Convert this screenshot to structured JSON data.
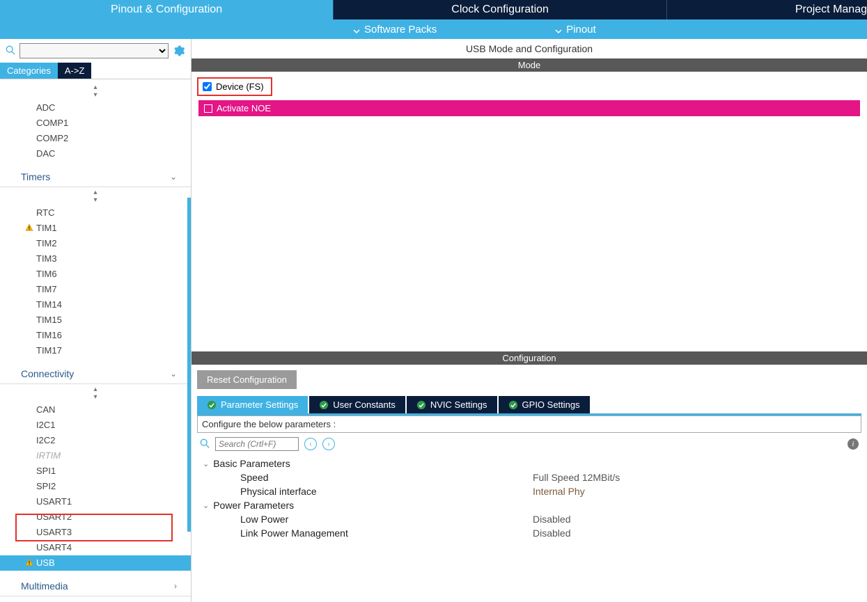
{
  "topTabs": {
    "pinout": "Pinout & Configuration",
    "clock": "Clock Configuration",
    "project": "Project Manag"
  },
  "subbar": {
    "software_packs": "Software Packs",
    "pinout": "Pinout"
  },
  "left": {
    "catTab": "Categories",
    "azTab": "A->Z",
    "search_placeholder": "",
    "analog_items": [
      "ADC",
      "COMP1",
      "COMP2",
      "DAC"
    ],
    "timers_label": "Timers",
    "timers_items": [
      "RTC",
      "TIM1",
      "TIM2",
      "TIM3",
      "TIM6",
      "TIM7",
      "TIM14",
      "TIM15",
      "TIM16",
      "TIM17"
    ],
    "timers_warn_index": 1,
    "connectivity_label": "Connectivity",
    "connectivity_items": [
      "CAN",
      "I2C1",
      "I2C2",
      "IRTIM",
      "SPI1",
      "SPI2",
      "USART1",
      "USART2",
      "USART3",
      "USART4",
      "USB"
    ],
    "connectivity_dim": "IRTIM",
    "connectivity_selected": "USB",
    "multimedia_label": "Multimedia"
  },
  "right": {
    "title": "USB Mode and Configuration",
    "mode_label": "Mode",
    "device_fs": "Device (FS)",
    "activate_noe": "Activate NOE",
    "config_label": "Configuration",
    "reset": "Reset Configuration",
    "tabs": {
      "param": "Parameter Settings",
      "user": "User Constants",
      "nvic": "NVIC Settings",
      "gpio": "GPIO Settings"
    },
    "configure_desc": "Configure the below parameters :",
    "search_ph": "Search (Crtl+F)",
    "groups": {
      "basic": "Basic Parameters",
      "power": "Power Parameters"
    },
    "params": {
      "speed_k": "Speed",
      "speed_v": "Full Speed 12MBit/s",
      "phy_k": "Physical interface",
      "phy_v": "Internal Phy",
      "low_k": "Low Power",
      "low_v": "Disabled",
      "link_k": "Link Power Management",
      "link_v": "Disabled"
    }
  }
}
